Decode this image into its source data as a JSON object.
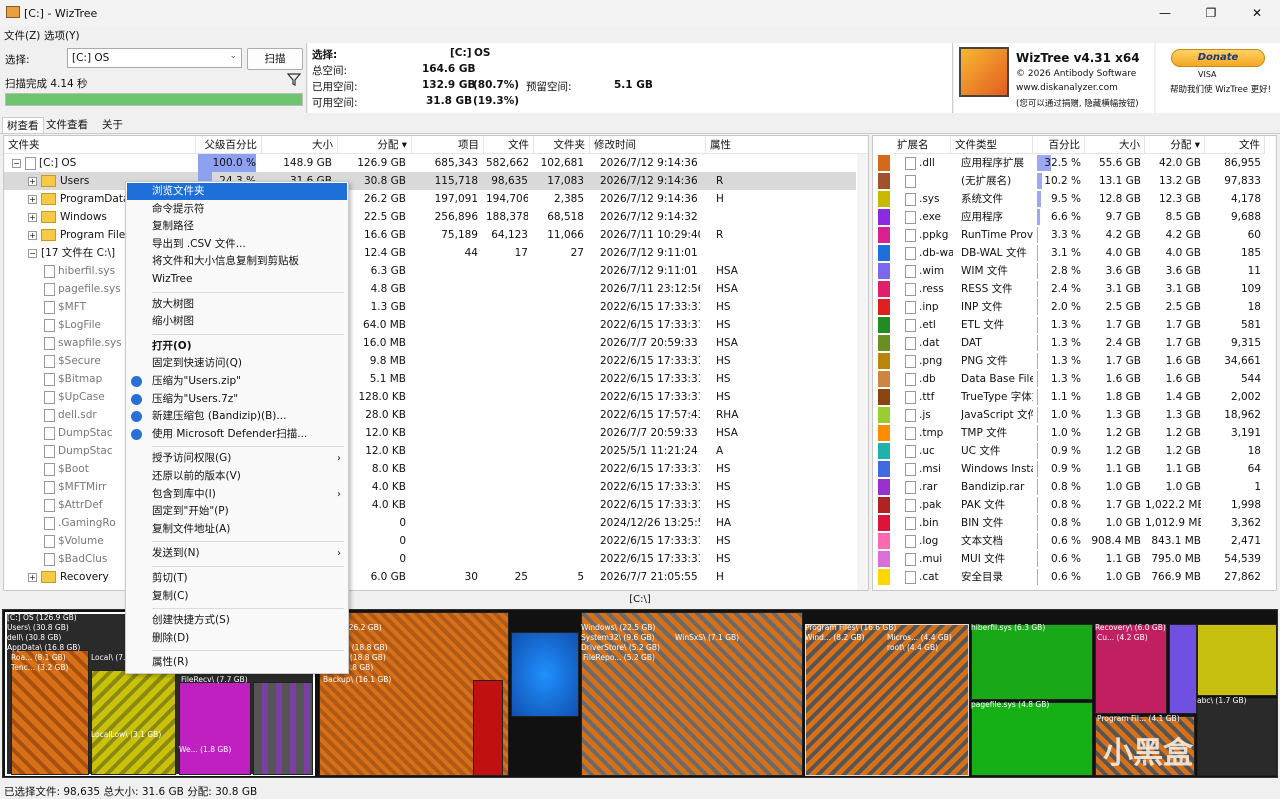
{
  "title": "[C:]  - WizTree",
  "window_controls": {
    "min": "—",
    "max": "❐",
    "close": "✕"
  },
  "menu": [
    "文件(Z)",
    "选项(Y)"
  ],
  "scan": {
    "select_label": "选择:",
    "drive": "[C:] OS",
    "scan_button": "扫描",
    "status": "扫描完成 4.14 秒",
    "progress": 1.0
  },
  "stats": {
    "select_label": "选择:",
    "select_value": "[C:]",
    "select_name": "OS",
    "total_label": "总空间:",
    "total_value": "164.6 GB",
    "used_label": "已用空间:",
    "used_value": "132.9 GB",
    "used_pct": "(80.7%)",
    "reserved_label": "预留空间:",
    "reserved_value": "5.1 GB",
    "free_label": "可用空间:",
    "free_value": "31.8 GB",
    "free_pct": "(19.3%)"
  },
  "logo": {
    "name": "WizTree v4.31 x64",
    "copyright": "© 2026 Antibody Software",
    "url": "www.diskanalyzer.com",
    "note": "(您可以通过捐赠, 隐藏横幅按钮)"
  },
  "donate": {
    "button": "Donate",
    "cards": "VISA",
    "text": "帮助我们使 WizTree 更好!"
  },
  "tabs": [
    "树查看",
    "文件查看",
    "关于"
  ],
  "tree_headers": [
    "文件夹",
    "父级百分比",
    "大小",
    "分配 ▾",
    "项目",
    "文件",
    "文件夹",
    "修改时间",
    "属性"
  ],
  "tree_rows": [
    {
      "name": "[C:] OS",
      "pct": "100.0 %",
      "size": "148.9 GB",
      "alloc": "126.9 GB",
      "items": "685,343",
      "files": "582,662",
      "folders": "102,681",
      "modified": "2026/7/12 9:14:36",
      "attr": ""
    },
    {
      "name": "Users",
      "pct": "24.3 %",
      "size": "31.6 GB",
      "alloc": "30.8 GB",
      "items": "115,718",
      "files": "98,635",
      "folders": "17,083",
      "modified": "2026/7/12 9:14:36",
      "attr": "R"
    },
    {
      "name": "ProgramData",
      "pct": "",
      "size": "",
      "alloc": "26.2 GB",
      "items": "197,091",
      "files": "194,706",
      "folders": "2,385",
      "modified": "2026/7/12 9:14:36",
      "attr": "H"
    },
    {
      "name": "Windows",
      "pct": "",
      "size": "",
      "alloc": "22.5 GB",
      "items": "256,896",
      "files": "188,378",
      "folders": "68,518",
      "modified": "2026/7/12 9:14:32",
      "attr": ""
    },
    {
      "name": "Program Files",
      "pct": "",
      "size": "",
      "alloc": "16.6 GB",
      "items": "75,189",
      "files": "64,123",
      "folders": "11,066",
      "modified": "2026/7/11 10:29:40",
      "attr": "R"
    },
    {
      "name": "[17 文件在 C:\\]",
      "pct": "",
      "size": "",
      "alloc": "12.4 GB",
      "items": "44",
      "files": "17",
      "folders": "27",
      "modified": "2026/7/12 9:11:01",
      "attr": ""
    },
    {
      "name": "hiberfil.sys",
      "pct": "",
      "size": "",
      "alloc": "6.3 GB",
      "items": "",
      "files": "",
      "folders": "",
      "modified": "2026/7/12 9:11:01",
      "attr": "HSA"
    },
    {
      "name": "pagefile.sys",
      "pct": "",
      "size": "",
      "alloc": "4.8 GB",
      "items": "",
      "files": "",
      "folders": "",
      "modified": "2026/7/11 23:12:56",
      "attr": "HSA"
    },
    {
      "name": "$MFT",
      "pct": "",
      "size": "",
      "alloc": "1.3 GB",
      "items": "",
      "files": "",
      "folders": "",
      "modified": "2022/6/15 17:33:31",
      "attr": "HS"
    },
    {
      "name": "$LogFile",
      "pct": "",
      "size": "",
      "alloc": "64.0 MB",
      "items": "",
      "files": "",
      "folders": "",
      "modified": "2022/6/15 17:33:31",
      "attr": "HS"
    },
    {
      "name": "swapfile.sys",
      "pct": "",
      "size": "",
      "alloc": "16.0 MB",
      "items": "",
      "files": "",
      "folders": "",
      "modified": "2026/7/7 20:59:33",
      "attr": "HSA"
    },
    {
      "name": "$Secure",
      "pct": "",
      "size": "",
      "alloc": "9.8 MB",
      "items": "",
      "files": "",
      "folders": "",
      "modified": "2022/6/15 17:33:31",
      "attr": "HS"
    },
    {
      "name": "$Bitmap",
      "pct": "",
      "size": "",
      "alloc": "5.1 MB",
      "items": "",
      "files": "",
      "folders": "",
      "modified": "2022/6/15 17:33:31",
      "attr": "HS"
    },
    {
      "name": "$UpCase",
      "pct": "",
      "size": "",
      "alloc": "128.0 KB",
      "items": "",
      "files": "",
      "folders": "",
      "modified": "2022/6/15 17:33:31",
      "attr": "HS"
    },
    {
      "name": "dell.sdr",
      "pct": "",
      "size": "",
      "alloc": "28.0 KB",
      "items": "",
      "files": "",
      "folders": "",
      "modified": "2022/6/15 17:57:43",
      "attr": "RHA"
    },
    {
      "name": "DumpStac",
      "pct": "",
      "size": "",
      "alloc": "12.0 KB",
      "items": "",
      "files": "",
      "folders": "",
      "modified": "2026/7/7 20:59:33",
      "attr": "HSA"
    },
    {
      "name": "DumpStac",
      "pct": "",
      "size": "",
      "alloc": "12.0 KB",
      "items": "",
      "files": "",
      "folders": "",
      "modified": "2025/5/1 11:21:24",
      "attr": "A"
    },
    {
      "name": "$Boot",
      "pct": "",
      "size": "",
      "alloc": "8.0 KB",
      "items": "",
      "files": "",
      "folders": "",
      "modified": "2022/6/15 17:33:31",
      "attr": "HS"
    },
    {
      "name": "$MFTMirr",
      "pct": "",
      "size": "",
      "alloc": "4.0 KB",
      "items": "",
      "files": "",
      "folders": "",
      "modified": "2022/6/15 17:33:31",
      "attr": "HS"
    },
    {
      "name": "$AttrDef",
      "pct": "",
      "size": "",
      "alloc": "4.0 KB",
      "items": "",
      "files": "",
      "folders": "",
      "modified": "2022/6/15 17:33:31",
      "attr": "HS"
    },
    {
      "name": ".GamingRo",
      "pct": "",
      "size": "",
      "alloc": "0",
      "items": "",
      "files": "",
      "folders": "",
      "modified": "2024/12/26 13:25:59",
      "attr": "HA"
    },
    {
      "name": "$Volume",
      "pct": "",
      "size": "",
      "alloc": "0",
      "items": "",
      "files": "",
      "folders": "",
      "modified": "2022/6/15 17:33:31",
      "attr": "HS"
    },
    {
      "name": "$BadClus",
      "pct": "",
      "size": "",
      "alloc": "0",
      "items": "",
      "files": "",
      "folders": "",
      "modified": "2022/6/15 17:33:31",
      "attr": "HS"
    },
    {
      "name": "Recovery",
      "pct": "",
      "size": "",
      "alloc": "6.0 GB",
      "items": "30",
      "files": "25",
      "folders": "5",
      "modified": "2026/7/7 21:05:55",
      "attr": "H"
    }
  ],
  "ext_headers": [
    "扩展名",
    "文件类型",
    "百分比",
    "大小",
    "分配 ▾",
    "文件"
  ],
  "ext_rows": [
    {
      "color": "#d4691a",
      "ext": ".dll",
      "type": "应用程序扩展",
      "pct": "32.5 %",
      "pctv": 32.5,
      "size": "55.6 GB",
      "alloc": "42.0 GB",
      "files": "86,955"
    },
    {
      "color": "#a0522d",
      "ext": "",
      "type": "(无扩展名)",
      "pct": "10.2 %",
      "pctv": 10.2,
      "size": "13.1 GB",
      "alloc": "13.2 GB",
      "files": "97,833"
    },
    {
      "color": "#c8b800",
      "ext": ".sys",
      "type": "系统文件",
      "pct": "9.5 %",
      "pctv": 9.5,
      "size": "12.8 GB",
      "alloc": "12.3 GB",
      "files": "4,178"
    },
    {
      "color": "#8a2be2",
      "ext": ".exe",
      "type": "应用程序",
      "pct": "6.6 %",
      "pctv": 6.6,
      "size": "9.7 GB",
      "alloc": "8.5 GB",
      "files": "9,688"
    },
    {
      "color": "#d8208f",
      "ext": ".ppkg",
      "type": "RunTime Provisi",
      "pct": "3.3 %",
      "pctv": 3.3,
      "size": "4.2 GB",
      "alloc": "4.2 GB",
      "files": "60"
    },
    {
      "color": "#1e6fd9",
      "ext": ".db-wal",
      "type": "DB-WAL 文件",
      "pct": "3.1 %",
      "pctv": 3.1,
      "size": "4.0 GB",
      "alloc": "4.0 GB",
      "files": "185"
    },
    {
      "color": "#7b68ee",
      "ext": ".wim",
      "type": "WIM 文件",
      "pct": "2.8 %",
      "pctv": 2.8,
      "size": "3.6 GB",
      "alloc": "3.6 GB",
      "files": "11"
    },
    {
      "color": "#e0206a",
      "ext": ".ress",
      "type": "RESS 文件",
      "pct": "2.4 %",
      "pctv": 2.4,
      "size": "3.1 GB",
      "alloc": "3.1 GB",
      "files": "109"
    },
    {
      "color": "#e02020",
      "ext": ".inp",
      "type": "INP 文件",
      "pct": "2.0 %",
      "pctv": 2.0,
      "size": "2.5 GB",
      "alloc": "2.5 GB",
      "files": "18"
    },
    {
      "color": "#228b22",
      "ext": ".etl",
      "type": "ETL 文件",
      "pct": "1.3 %",
      "pctv": 1.3,
      "size": "1.7 GB",
      "alloc": "1.7 GB",
      "files": "581"
    },
    {
      "color": "#6b8e23",
      "ext": ".dat",
      "type": "DAT",
      "pct": "1.3 %",
      "pctv": 1.3,
      "size": "2.4 GB",
      "alloc": "1.7 GB",
      "files": "9,315"
    },
    {
      "color": "#b8860b",
      "ext": ".png",
      "type": "PNG 文件",
      "pct": "1.3 %",
      "pctv": 1.3,
      "size": "1.7 GB",
      "alloc": "1.6 GB",
      "files": "34,661"
    },
    {
      "color": "#cd853f",
      "ext": ".db",
      "type": "Data Base File",
      "pct": "1.3 %",
      "pctv": 1.3,
      "size": "1.6 GB",
      "alloc": "1.6 GB",
      "files": "544"
    },
    {
      "color": "#8b4513",
      "ext": ".ttf",
      "type": "TrueType 字体文",
      "pct": "1.1 %",
      "pctv": 1.1,
      "size": "1.8 GB",
      "alloc": "1.4 GB",
      "files": "2,002"
    },
    {
      "color": "#9acd32",
      "ext": ".js",
      "type": "JavaScript 文件",
      "pct": "1.0 %",
      "pctv": 1.0,
      "size": "1.3 GB",
      "alloc": "1.3 GB",
      "files": "18,962"
    },
    {
      "color": "#ff8c00",
      "ext": ".tmp",
      "type": "TMP 文件",
      "pct": "1.0 %",
      "pctv": 1.0,
      "size": "1.2 GB",
      "alloc": "1.2 GB",
      "files": "3,191"
    },
    {
      "color": "#20b2aa",
      "ext": ".uc",
      "type": "UC 文件",
      "pct": "0.9 %",
      "pctv": 0.9,
      "size": "1.2 GB",
      "alloc": "1.2 GB",
      "files": "18"
    },
    {
      "color": "#4169e1",
      "ext": ".msi",
      "type": "Windows Installe",
      "pct": "0.9 %",
      "pctv": 0.9,
      "size": "1.1 GB",
      "alloc": "1.1 GB",
      "files": "64"
    },
    {
      "color": "#9932cc",
      "ext": ".rar",
      "type": "Bandizip.rar",
      "pct": "0.8 %",
      "pctv": 0.8,
      "size": "1.0 GB",
      "alloc": "1.0 GB",
      "files": "1"
    },
    {
      "color": "#b22222",
      "ext": ".pak",
      "type": "PAK 文件",
      "pct": "0.8 %",
      "pctv": 0.8,
      "size": "1.7 GB",
      "alloc": "1,022.2 MB",
      "files": "1,998"
    },
    {
      "color": "#dc143c",
      "ext": ".bin",
      "type": "BIN 文件",
      "pct": "0.8 %",
      "pctv": 0.8,
      "size": "1.0 GB",
      "alloc": "1,012.9 MB",
      "files": "3,362"
    },
    {
      "color": "#ff69b4",
      "ext": ".log",
      "type": "文本文档",
      "pct": "0.6 %",
      "pctv": 0.6,
      "size": "908.4 MB",
      "alloc": "843.1 MB",
      "files": "2,471"
    },
    {
      "color": "#da70d6",
      "ext": ".mui",
      "type": "MUI 文件",
      "pct": "0.6 %",
      "pctv": 0.6,
      "size": "1.1 GB",
      "alloc": "795.0 MB",
      "files": "54,539"
    },
    {
      "color": "#ffd700",
      "ext": ".cat",
      "type": "安全目录",
      "pct": "0.6 %",
      "pctv": 0.6,
      "size": "1.0 GB",
      "alloc": "766.9 MB",
      "files": "27,862"
    }
  ],
  "path_bar": "[C:\\]",
  "treemap_labels": [
    "[C:] OS (126.9 GB)",
    "Users\\ (30.8 GB)",
    "dell\\ (30.8 GB)",
    "AppData\\ (16.8 GB)",
    "Roa... (8.1 GB)",
    "Local\\ (7.4 GB)",
    "Tenc... (3.2 GB)",
    "FileRecv\\ (7.7 GB)",
    "LocalLow\\ (3.1 GB)",
    "We... (1.8 GB)",
    "Data\\ (26.2 GB)",
    "7 GB)",
    "diation\\ (18.8 GB)",
    "Repair\\ (18.8 GB)",
    "ots\\ (18.8 GB)",
    "Backup\\ (16.1 GB)",
    "Windows\\ (22.5 GB)",
    "System32\\ (9.6 GB)",
    "DriverStore\\ (5.2 GB)",
    "FileRepo... (5.2 GB)",
    "WinSxS\\ (7.1 GB)",
    "Program Files\\ (16.6 GB)",
    "Wind... (8.2 GB)",
    "Micros... (4.4 GB)",
    "root\\ (4.4 GB)",
    "hiberfil.sys (6.3 GB)",
    "pagefile.sys (4.8 GB)",
    "Recovery\\ (6.0 GB)",
    "Cu... (4.2 GB)",
    "Program Fil... (4.1 GB)",
    "abc\\ (1.7 GB)"
  ],
  "status_bar": "已选择文件: 98,635  总大小: 31.6 GB  分配: 30.8 GB",
  "context_menu": [
    {
      "label": "浏览文件夹",
      "highlight": true
    },
    {
      "label": "命令提示符"
    },
    {
      "label": "复制路径"
    },
    {
      "label": "导出到 .CSV 文件..."
    },
    {
      "label": "将文件和大小信息复制到剪贴板"
    },
    {
      "label": "WizTree"
    },
    {
      "sep": true
    },
    {
      "label": "放大树图"
    },
    {
      "label": "缩小树图"
    },
    {
      "sep": true
    },
    {
      "label": "打开(O)",
      "bold": true
    },
    {
      "label": "固定到快速访问(Q)"
    },
    {
      "label": "压缩为\"Users.zip\"",
      "icon": true
    },
    {
      "label": "压缩为\"Users.7z\"",
      "icon": true
    },
    {
      "label": "新建压缩包 (Bandizip)(B)...",
      "icon": true
    },
    {
      "label": "使用 Microsoft Defender扫描...",
      "icon": true
    },
    {
      "sep": true
    },
    {
      "label": "授予访问权限(G)",
      "sub": true
    },
    {
      "label": "还原以前的版本(V)"
    },
    {
      "label": "包含到库中(I)",
      "sub": true
    },
    {
      "label": "固定到\"开始\"(P)"
    },
    {
      "label": "复制文件地址(A)"
    },
    {
      "sep": true
    },
    {
      "label": "发送到(N)",
      "sub": true
    },
    {
      "sep": true
    },
    {
      "label": "剪切(T)"
    },
    {
      "label": "复制(C)"
    },
    {
      "sep": true
    },
    {
      "label": "创建快捷方式(S)"
    },
    {
      "label": "删除(D)"
    },
    {
      "sep": true
    },
    {
      "label": "属性(R)"
    }
  ],
  "watermark": "小黑盒"
}
